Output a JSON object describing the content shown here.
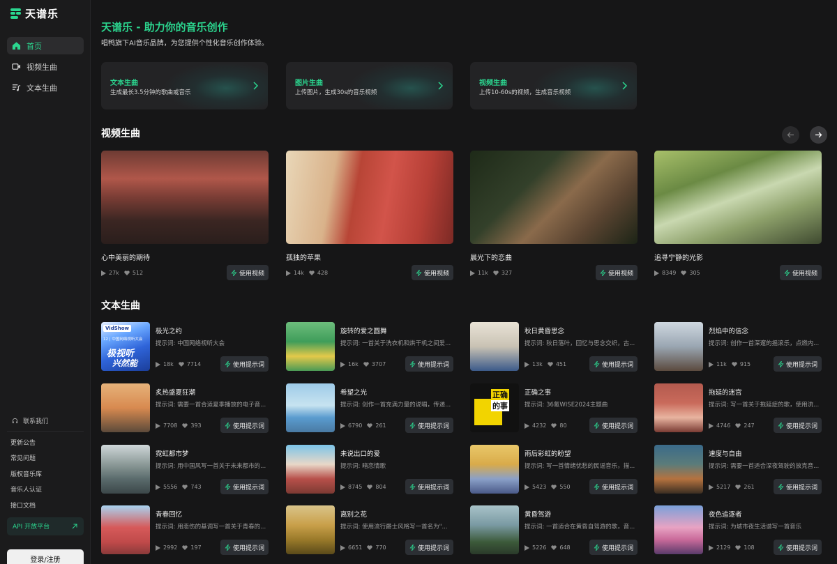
{
  "brand": {
    "name": "天谱乐",
    "accent": "#2bd68f"
  },
  "nav": [
    {
      "label": "首页",
      "icon": "home-icon",
      "active": true
    },
    {
      "label": "视频生曲",
      "icon": "video-icon",
      "active": false
    },
    {
      "label": "文本生曲",
      "icon": "text-music-icon",
      "active": false
    }
  ],
  "sidebar_bottom": {
    "contact": "联系我们",
    "links": [
      "更新公告",
      "常见问题",
      "版权音乐库",
      "音乐人认证",
      "接口文档"
    ],
    "api": "API 开放平台",
    "login": "登录/注册"
  },
  "hero": {
    "title": "天谱乐 - 助力你的音乐创作",
    "subtitle": "唱鸭旗下AI音乐品牌，为您提供个性化音乐创作体验。"
  },
  "features": [
    {
      "title": "文本生曲",
      "desc": "生成最长3.5分钟的歌曲或音乐"
    },
    {
      "title": "图片生曲",
      "desc": "上传图片，生成30s的音乐视频"
    },
    {
      "title": "视频生曲",
      "desc": "上传10-60s的视频，生成音乐视频"
    }
  ],
  "video_section": {
    "title": "视频生曲",
    "use_label": "使用视频",
    "items": [
      {
        "title": "心中美丽的期待",
        "plays": "27k",
        "likes": "512"
      },
      {
        "title": "孤独的苹果",
        "plays": "14k",
        "likes": "428"
      },
      {
        "title": "晨光下的恋曲",
        "plays": "11k",
        "likes": "327"
      },
      {
        "title": "追寻宁静的光影",
        "plays": "8349",
        "likes": "305"
      }
    ]
  },
  "text_section": {
    "title": "文本生曲",
    "use_label": "使用提示词",
    "items": [
      {
        "title": "极光之约",
        "prompt": "提示词: 中国网络视听大会",
        "plays": "18k",
        "likes": "7714"
      },
      {
        "title": "旋转的爱之圆舞",
        "prompt": "提示词: 一首关于洗衣机和烘干机之间爱...",
        "plays": "16k",
        "likes": "3707"
      },
      {
        "title": "秋日黄昏思念",
        "prompt": "提示词: 秋日落叶，回忆与思念交织，古...",
        "plays": "13k",
        "likes": "451"
      },
      {
        "title": "烈焰中的信念",
        "prompt": "提示词: 创作一首深邃的摇滚乐，点燃内...",
        "plays": "11k",
        "likes": "915"
      },
      {
        "title": "炙热盛夏狂潮",
        "prompt": "提示词: 需要一首合适夏季播放的电子音...",
        "plays": "7708",
        "likes": "393"
      },
      {
        "title": "希望之光",
        "prompt": "提示词: 创作一首充满力量的说唱，传递...",
        "plays": "6790",
        "likes": "261"
      },
      {
        "title": "正确之事",
        "prompt": "提示词: 36氪WISE2024主题曲",
        "plays": "4232",
        "likes": "80"
      },
      {
        "title": "拖延的迷宫",
        "prompt": "提示词: 写一首关于拖延症的歌，使用流...",
        "plays": "4746",
        "likes": "247"
      },
      {
        "title": "霓虹都市梦",
        "prompt": "提示词: 用中国风写一首关于未来都市的...",
        "plays": "5556",
        "likes": "743"
      },
      {
        "title": "未说出口的爱",
        "prompt": "提示词: 暗恋情歌",
        "plays": "8745",
        "likes": "804"
      },
      {
        "title": "雨后彩虹的盼望",
        "prompt": "提示词: 写一首情绪忧愁的民谣音乐，描...",
        "plays": "5423",
        "likes": "550"
      },
      {
        "title": "速度与自由",
        "prompt": "提示词: 需要一首适合深夜驾驶的放克音...",
        "plays": "5217",
        "likes": "261"
      },
      {
        "title": "青春回忆",
        "prompt": "提示词: 用悲伤的基调写一首关于青春的...",
        "plays": "2992",
        "likes": "197"
      },
      {
        "title": "离别之花",
        "prompt": "提示词: 使用流行爵士风格写一首名为\"...",
        "plays": "6651",
        "likes": "770"
      },
      {
        "title": "黄昏驾游",
        "prompt": "提示词: 一首适合在黄昏自驾游的歌，音...",
        "plays": "5226",
        "likes": "648"
      },
      {
        "title": "夜色追逐者",
        "prompt": "提示词: 为城市夜生活谱写一首音乐",
        "plays": "2129",
        "likes": "108"
      }
    ]
  },
  "thumb_text": {
    "t0_badge": "VidShow",
    "t0_line": "12 | 中国网络视听大会",
    "t0_big1": "极视听",
    "t0_big2": "兴然能",
    "t6_big1": "正确",
    "t6_big2": "的事"
  }
}
